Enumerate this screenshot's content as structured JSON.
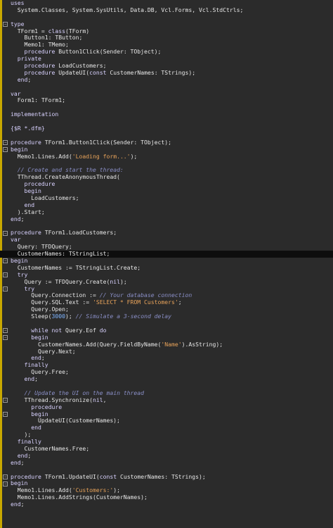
{
  "editor": {
    "lines": [
      [
        {
          "t": "uses",
          "k": "kw"
        }
      ],
      [
        {
          "t": "  System.Classes, System.SysUtils, Data.DB, Vcl.Forms, Vcl.StdCtrls;"
        }
      ],
      [],
      [
        {
          "t": "type",
          "k": "kw"
        }
      ],
      [
        {
          "t": "  TForm1 = "
        },
        {
          "t": "class",
          "k": "kw"
        },
        {
          "t": "(TForm)"
        }
      ],
      [
        {
          "t": "    Button1: TButton;"
        }
      ],
      [
        {
          "t": "    Memo1: TMemo;"
        }
      ],
      [
        {
          "t": "    "
        },
        {
          "t": "procedure",
          "k": "kw"
        },
        {
          "t": " Button1Click(Sender: TObject);"
        }
      ],
      [
        {
          "t": "  "
        },
        {
          "t": "private",
          "k": "kw"
        }
      ],
      [
        {
          "t": "    "
        },
        {
          "t": "procedure",
          "k": "kw"
        },
        {
          "t": " LoadCustomers;"
        }
      ],
      [
        {
          "t": "    "
        },
        {
          "t": "procedure",
          "k": "kw"
        },
        {
          "t": " UpdateUI("
        },
        {
          "t": "const",
          "k": "kw"
        },
        {
          "t": " CustomerNames: TStrings);"
        }
      ],
      [
        {
          "t": "  "
        },
        {
          "t": "end",
          "k": "kw"
        },
        {
          "t": ";"
        }
      ],
      [],
      [
        {
          "t": "var",
          "k": "kw"
        }
      ],
      [
        {
          "t": "  Form1: TForm1;"
        }
      ],
      [],
      [
        {
          "t": "implementation",
          "k": "kw"
        }
      ],
      [],
      [
        {
          "t": "{$R *.dfm}",
          "k": "dir"
        }
      ],
      [],
      [
        {
          "t": "procedure",
          "k": "kw"
        },
        {
          "t": " TForm1.Button1Click(Sender: TObject);"
        }
      ],
      [
        {
          "t": "begin",
          "k": "kw"
        }
      ],
      [
        {
          "t": "  Memo1.Lines.Add("
        },
        {
          "t": "'Loading form...'",
          "k": "str"
        },
        {
          "t": ");"
        }
      ],
      [],
      [
        {
          "t": "  "
        },
        {
          "t": "// Create and start the thread:",
          "k": "cmt"
        }
      ],
      [
        {
          "t": "  TThread.CreateAnonymousThread("
        }
      ],
      [
        {
          "t": "    "
        },
        {
          "t": "procedure",
          "k": "kw"
        }
      ],
      [
        {
          "t": "    "
        },
        {
          "t": "begin",
          "k": "kw"
        }
      ],
      [
        {
          "t": "      LoadCustomers;"
        }
      ],
      [
        {
          "t": "    "
        },
        {
          "t": "end",
          "k": "kw"
        }
      ],
      [
        {
          "t": "  ).Start;"
        }
      ],
      [
        {
          "t": "end",
          "k": "kw"
        },
        {
          "t": ";"
        }
      ],
      [],
      [
        {
          "t": "procedure",
          "k": "kw"
        },
        {
          "t": " TForm1.LoadCustomers;"
        }
      ],
      [
        {
          "t": "var",
          "k": "kw"
        }
      ],
      [
        {
          "t": "  Query: TFDQuery;"
        }
      ],
      [
        {
          "t": "  CustomerNames: TStringList;"
        }
      ],
      [
        {
          "t": "begin",
          "k": "kw"
        }
      ],
      [
        {
          "t": "  CustomerNames := TStringList.Create;"
        }
      ],
      [
        {
          "t": "  "
        },
        {
          "t": "try",
          "k": "kw"
        }
      ],
      [
        {
          "t": "    Query := TFDQuery.Create("
        },
        {
          "t": "nil",
          "k": "kw"
        },
        {
          "t": ");"
        }
      ],
      [
        {
          "t": "    "
        },
        {
          "t": "try",
          "k": "kw"
        }
      ],
      [
        {
          "t": "      Query.Connection := "
        },
        {
          "t": "// Your database connection",
          "k": "cmt"
        }
      ],
      [
        {
          "t": "      Query.SQL.Text := "
        },
        {
          "t": "'SELECT * FROM Customers'",
          "k": "str"
        },
        {
          "t": ";"
        }
      ],
      [
        {
          "t": "      Query.Open;"
        }
      ],
      [
        {
          "t": "      Sleep("
        },
        {
          "t": "3000",
          "k": "num"
        },
        {
          "t": "); "
        },
        {
          "t": "// Simulate a 3-second delay",
          "k": "cmt"
        }
      ],
      [],
      [
        {
          "t": "      "
        },
        {
          "t": "while not",
          "k": "kw"
        },
        {
          "t": " Query.Eof "
        },
        {
          "t": "do",
          "k": "kw"
        }
      ],
      [
        {
          "t": "      "
        },
        {
          "t": "begin",
          "k": "kw"
        }
      ],
      [
        {
          "t": "        CustomerNames.Add(Query.FieldByName("
        },
        {
          "t": "'Name'",
          "k": "str"
        },
        {
          "t": ").AsString);"
        }
      ],
      [
        {
          "t": "        Query.Next;"
        }
      ],
      [
        {
          "t": "      "
        },
        {
          "t": "end",
          "k": "kw"
        },
        {
          "t": ";"
        }
      ],
      [
        {
          "t": "    "
        },
        {
          "t": "finally",
          "k": "kw"
        }
      ],
      [
        {
          "t": "      Query.Free;"
        }
      ],
      [
        {
          "t": "    "
        },
        {
          "t": "end",
          "k": "kw"
        },
        {
          "t": ";"
        }
      ],
      [],
      [
        {
          "t": "    "
        },
        {
          "t": "// Update the UI on the main thread",
          "k": "cmt"
        }
      ],
      [
        {
          "t": "    TThread.Synchronize("
        },
        {
          "t": "nil",
          "k": "kw"
        },
        {
          "t": ","
        }
      ],
      [
        {
          "t": "      "
        },
        {
          "t": "procedure",
          "k": "kw"
        }
      ],
      [
        {
          "t": "      "
        },
        {
          "t": "begin",
          "k": "kw"
        }
      ],
      [
        {
          "t": "        UpdateUI(CustomerNames);"
        }
      ],
      [
        {
          "t": "      "
        },
        {
          "t": "end",
          "k": "kw"
        }
      ],
      [
        {
          "t": "    );"
        }
      ],
      [
        {
          "t": "  "
        },
        {
          "t": "finally",
          "k": "kw"
        }
      ],
      [
        {
          "t": "    CustomerNames.Free;"
        }
      ],
      [
        {
          "t": "  "
        },
        {
          "t": "end",
          "k": "kw"
        },
        {
          "t": ";"
        }
      ],
      [
        {
          "t": "end",
          "k": "kw"
        },
        {
          "t": ";"
        }
      ],
      [],
      [
        {
          "t": "procedure",
          "k": "kw"
        },
        {
          "t": " TForm1.UpdateUI("
        },
        {
          "t": "const",
          "k": "kw"
        },
        {
          "t": " CustomerNames: TStrings);"
        }
      ],
      [
        {
          "t": "begin",
          "k": "kw"
        }
      ],
      [
        {
          "t": "  Memo1.Lines.Add("
        },
        {
          "t": "'Customers:'",
          "k": "str"
        },
        {
          "t": ");"
        }
      ],
      [
        {
          "t": "  Memo1.Lines.AddStrings(CustomerNames);"
        }
      ],
      [
        {
          "t": "end",
          "k": "kw"
        },
        {
          "t": ";"
        }
      ]
    ],
    "fold_lines": [
      3,
      20,
      21,
      33,
      37,
      39,
      41,
      47,
      48,
      57,
      59,
      68,
      69
    ],
    "highlighted_line": 36
  }
}
